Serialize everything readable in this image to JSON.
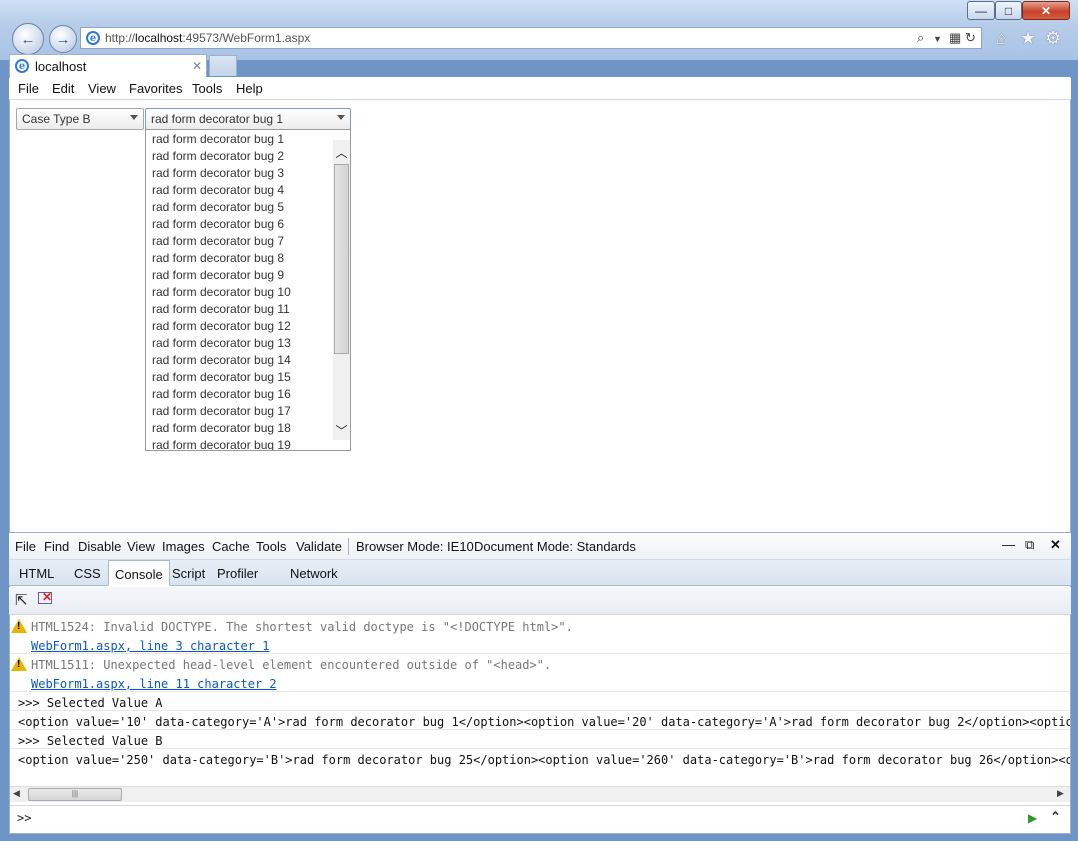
{
  "window": {
    "minimize_glyph": "—",
    "maximize_glyph": "□",
    "close_glyph": "✕"
  },
  "address_bar": {
    "url_prefix": "http://",
    "url_host": "localhost",
    "url_rest": ":49573/WebForm1.aspx"
  },
  "tab": {
    "title": "localhost",
    "close_glyph": "✕"
  },
  "browser_menu": {
    "file": "File",
    "edit": "Edit",
    "view": "View",
    "favorites": "Favorites",
    "tools": "Tools",
    "help": "Help"
  },
  "page": {
    "case_type_value": "Case Type B",
    "bug_select_value": "rad form decorator bug 1",
    "bug_options": [
      "rad form decorator bug 1",
      "rad form decorator bug 2",
      "rad form decorator bug 3",
      "rad form decorator bug 4",
      "rad form decorator bug 5",
      "rad form decorator bug 6",
      "rad form decorator bug 7",
      "rad form decorator bug 8",
      "rad form decorator bug 9",
      "rad form decorator bug 10",
      "rad form decorator bug 11",
      "rad form decorator bug 12",
      "rad form decorator bug 13",
      "rad form decorator bug 14",
      "rad form decorator bug 15",
      "rad form decorator bug 16",
      "rad form decorator bug 17",
      "rad form decorator bug 18",
      "rad form decorator bug 19"
    ]
  },
  "devtools": {
    "menu": {
      "file": "File",
      "find": "Find",
      "disable": "Disable",
      "view": "View",
      "images": "Images",
      "cache": "Cache",
      "tools": "Tools",
      "validate": "Validate",
      "browser_mode_label": "Browser Mode:",
      "browser_mode_value": "IE10",
      "document_mode_label": "Document Mode:",
      "document_mode_value": "Standards"
    },
    "tabs": [
      "HTML",
      "CSS",
      "Console",
      "Script",
      "Profiler",
      "Network"
    ],
    "active_tab": "Console",
    "console": {
      "warning1": "HTML1524: Invalid DOCTYPE. The shortest valid doctype is \"<!DOCTYPE html>\".",
      "warning1_link": "WebForm1.aspx, line 3 character 1",
      "warning2": "HTML1511: Unexpected head-level element encountered outside of \"<head>\".",
      "warning2_link": "WebForm1.aspx, line 11 character 2",
      "log1": ">>> Selected Value A",
      "log1_output": "<option value='10' data-category='A'>rad form decorator bug 1</option><option value='20' data-category='A'>rad form decorator bug 2</option><option va",
      "log2": ">>> Selected Value B",
      "log2_output": "<option value='250' data-category='B'>rad form decorator bug 25</option><option value='260' data-category='B'>rad form decorator bug 26</option><optio"
    },
    "command_prompt": ">>"
  }
}
